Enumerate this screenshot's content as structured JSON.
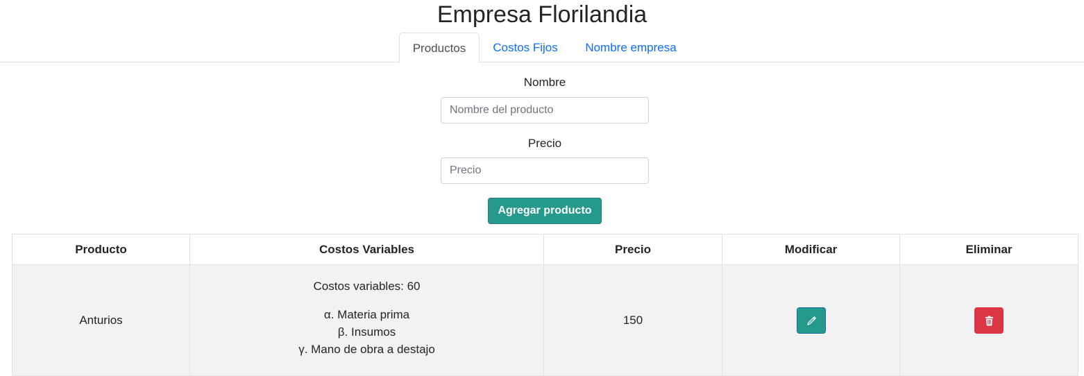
{
  "header": {
    "title": "Empresa Florilandia"
  },
  "tabs": [
    {
      "label": "Productos",
      "active": true
    },
    {
      "label": "Costos Fijos",
      "active": false
    },
    {
      "label": "Nombre empresa",
      "active": false
    }
  ],
  "form": {
    "name_label": "Nombre",
    "name_placeholder": "Nombre del producto",
    "name_value": "",
    "price_label": "Precio",
    "price_placeholder": "Precio",
    "price_value": "",
    "add_button": "Agregar producto"
  },
  "table": {
    "headers": [
      "Producto",
      "Costos Variables",
      "Precio",
      "Modificar",
      "Eliminar"
    ],
    "rows": [
      {
        "product": "Anturios",
        "variable_costs_title": "Costos variables: 60",
        "variable_costs_items": [
          "α. Materia prima",
          "β. Insumos",
          "γ. Mano de obra a destajo"
        ],
        "price": "150"
      }
    ]
  },
  "colors": {
    "accent": "#26998d",
    "danger": "#dc3545",
    "link": "#0d6efd",
    "row_bg": "#f2f2f2"
  },
  "icons": {
    "edit": "pencil-icon",
    "delete": "trash-icon"
  }
}
